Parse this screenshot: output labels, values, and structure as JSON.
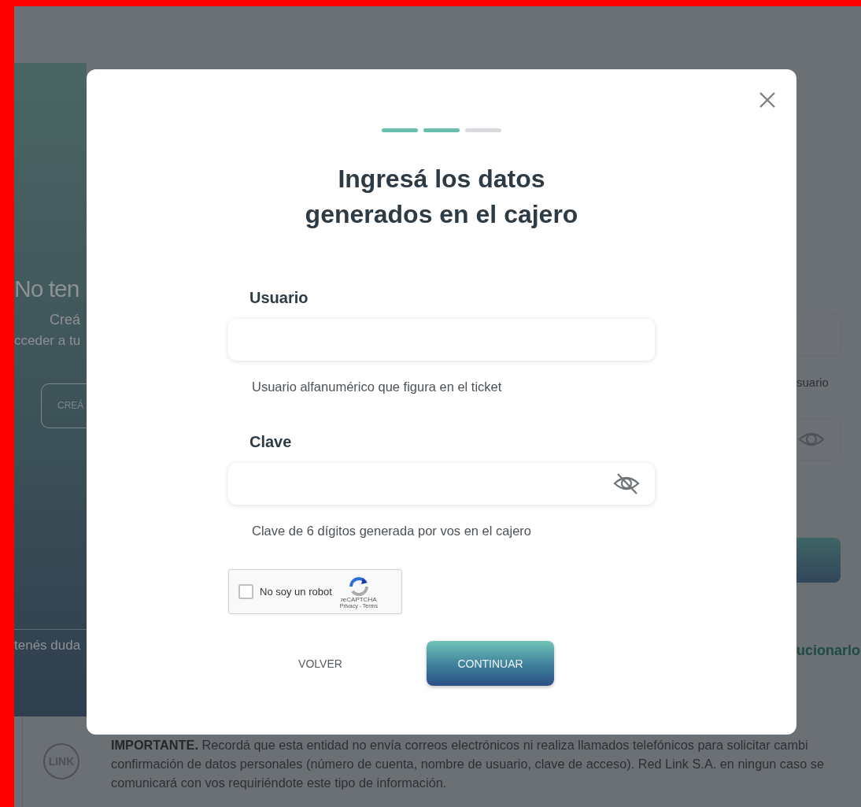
{
  "background": {
    "left_panel": {
      "title": "No ten",
      "line_1": "Creá",
      "line_2": "cceder a tu",
      "button": "CREÁ",
      "footer_text": "tenés duda"
    },
    "right_panel": {
      "helper": "suario",
      "password_visible": true,
      "link": "ucionarlo"
    },
    "notice": {
      "logo": "LINK",
      "lines": [
        "**IMPORTANTE.** Recordá que esta entidad no envía correos electrónicos ni realiza llamados telefónicos para solicitar cambi",
        "confirmación de datos personales (número de cuenta, nombre de usuario, clave de acceso). Red Link S.A. en ningun caso se",
        "comunicará con vos requiriéndote este tipo de información."
      ]
    }
  },
  "modal": {
    "progress": [
      {
        "done": true
      },
      {
        "done": true
      },
      {
        "done": false
      }
    ],
    "title": "Ingresá los datos generados en el cajero",
    "fields": [
      {
        "kind": "text",
        "label": "Usuario",
        "helper": "Usuario alfanumérico que figura en el ticket"
      },
      {
        "kind": "password",
        "label": "Clave",
        "visible": false,
        "helper": "Clave de 6 dígitos generada por vos en el cajero"
      }
    ],
    "captcha": {
      "checked": false,
      "label": "No soy un robot",
      "brand": "reCAPTCHA",
      "links": "Privacy - Terms"
    },
    "buttons": [
      {
        "kind": "secondary",
        "label": "VOLVER"
      },
      {
        "kind": "primary",
        "label": "CONTINUAR"
      }
    ]
  }
}
